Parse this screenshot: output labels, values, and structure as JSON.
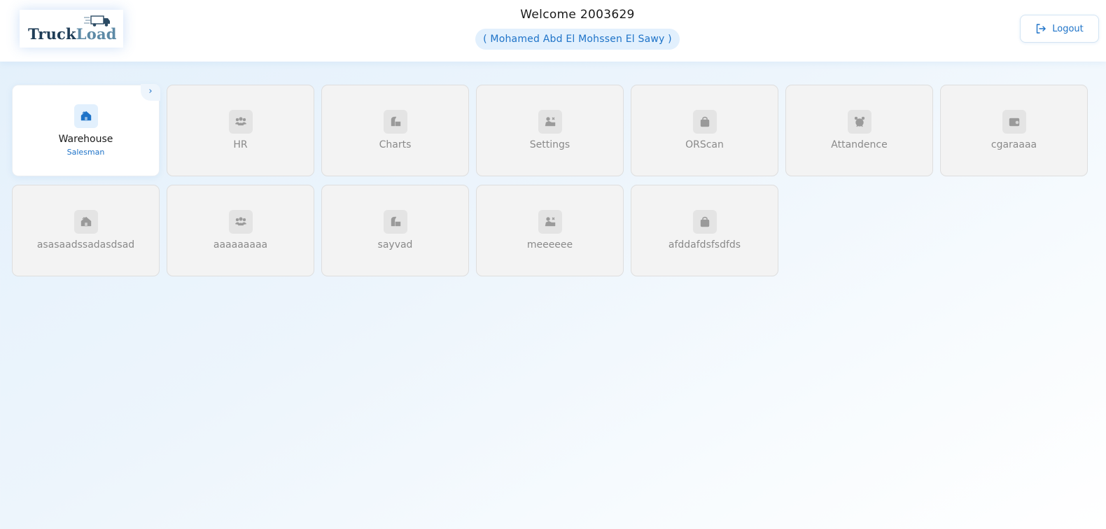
{
  "header": {
    "logo": {
      "part1": "Truck",
      "part2": "Load"
    },
    "welcome": "Welcome 2003629",
    "user_fullname": "( Mohamed Abd El Mohssen El Sawy )",
    "logout_label": "Logout"
  },
  "colors": {
    "accent": "#1e73c8",
    "accent_light": "#e2f0fd",
    "tile_bg": "#f3f3f3",
    "tile_icon_gray": "#9a9a9a"
  },
  "modules": [
    {
      "label": "Warehouse",
      "sub": "Salesman",
      "icon": "warehouse-icon",
      "active": true
    },
    {
      "label": "HR",
      "icon": "people-icon",
      "active": false
    },
    {
      "label": "Charts",
      "icon": "chart-icon",
      "active": false
    },
    {
      "label": "Settings",
      "icon": "settings-icon",
      "active": false
    },
    {
      "label": "ORScan",
      "icon": "bag-icon",
      "active": false
    },
    {
      "label": "Attandence",
      "icon": "alarm-clock-icon",
      "active": false
    },
    {
      "label": "cgaraaaa",
      "icon": "wallet-icon",
      "active": false
    },
    {
      "label": "asasaadssadasdsad",
      "icon": "warehouse-icon",
      "active": false
    },
    {
      "label": "aaaaaaaaa",
      "icon": "people-icon",
      "active": false
    },
    {
      "label": "sayvad",
      "icon": "chart-icon",
      "active": false
    },
    {
      "label": "meeeeee",
      "icon": "settings-icon",
      "active": false
    },
    {
      "label": "afddafdsfsdfds",
      "icon": "bag-icon",
      "active": false
    }
  ]
}
